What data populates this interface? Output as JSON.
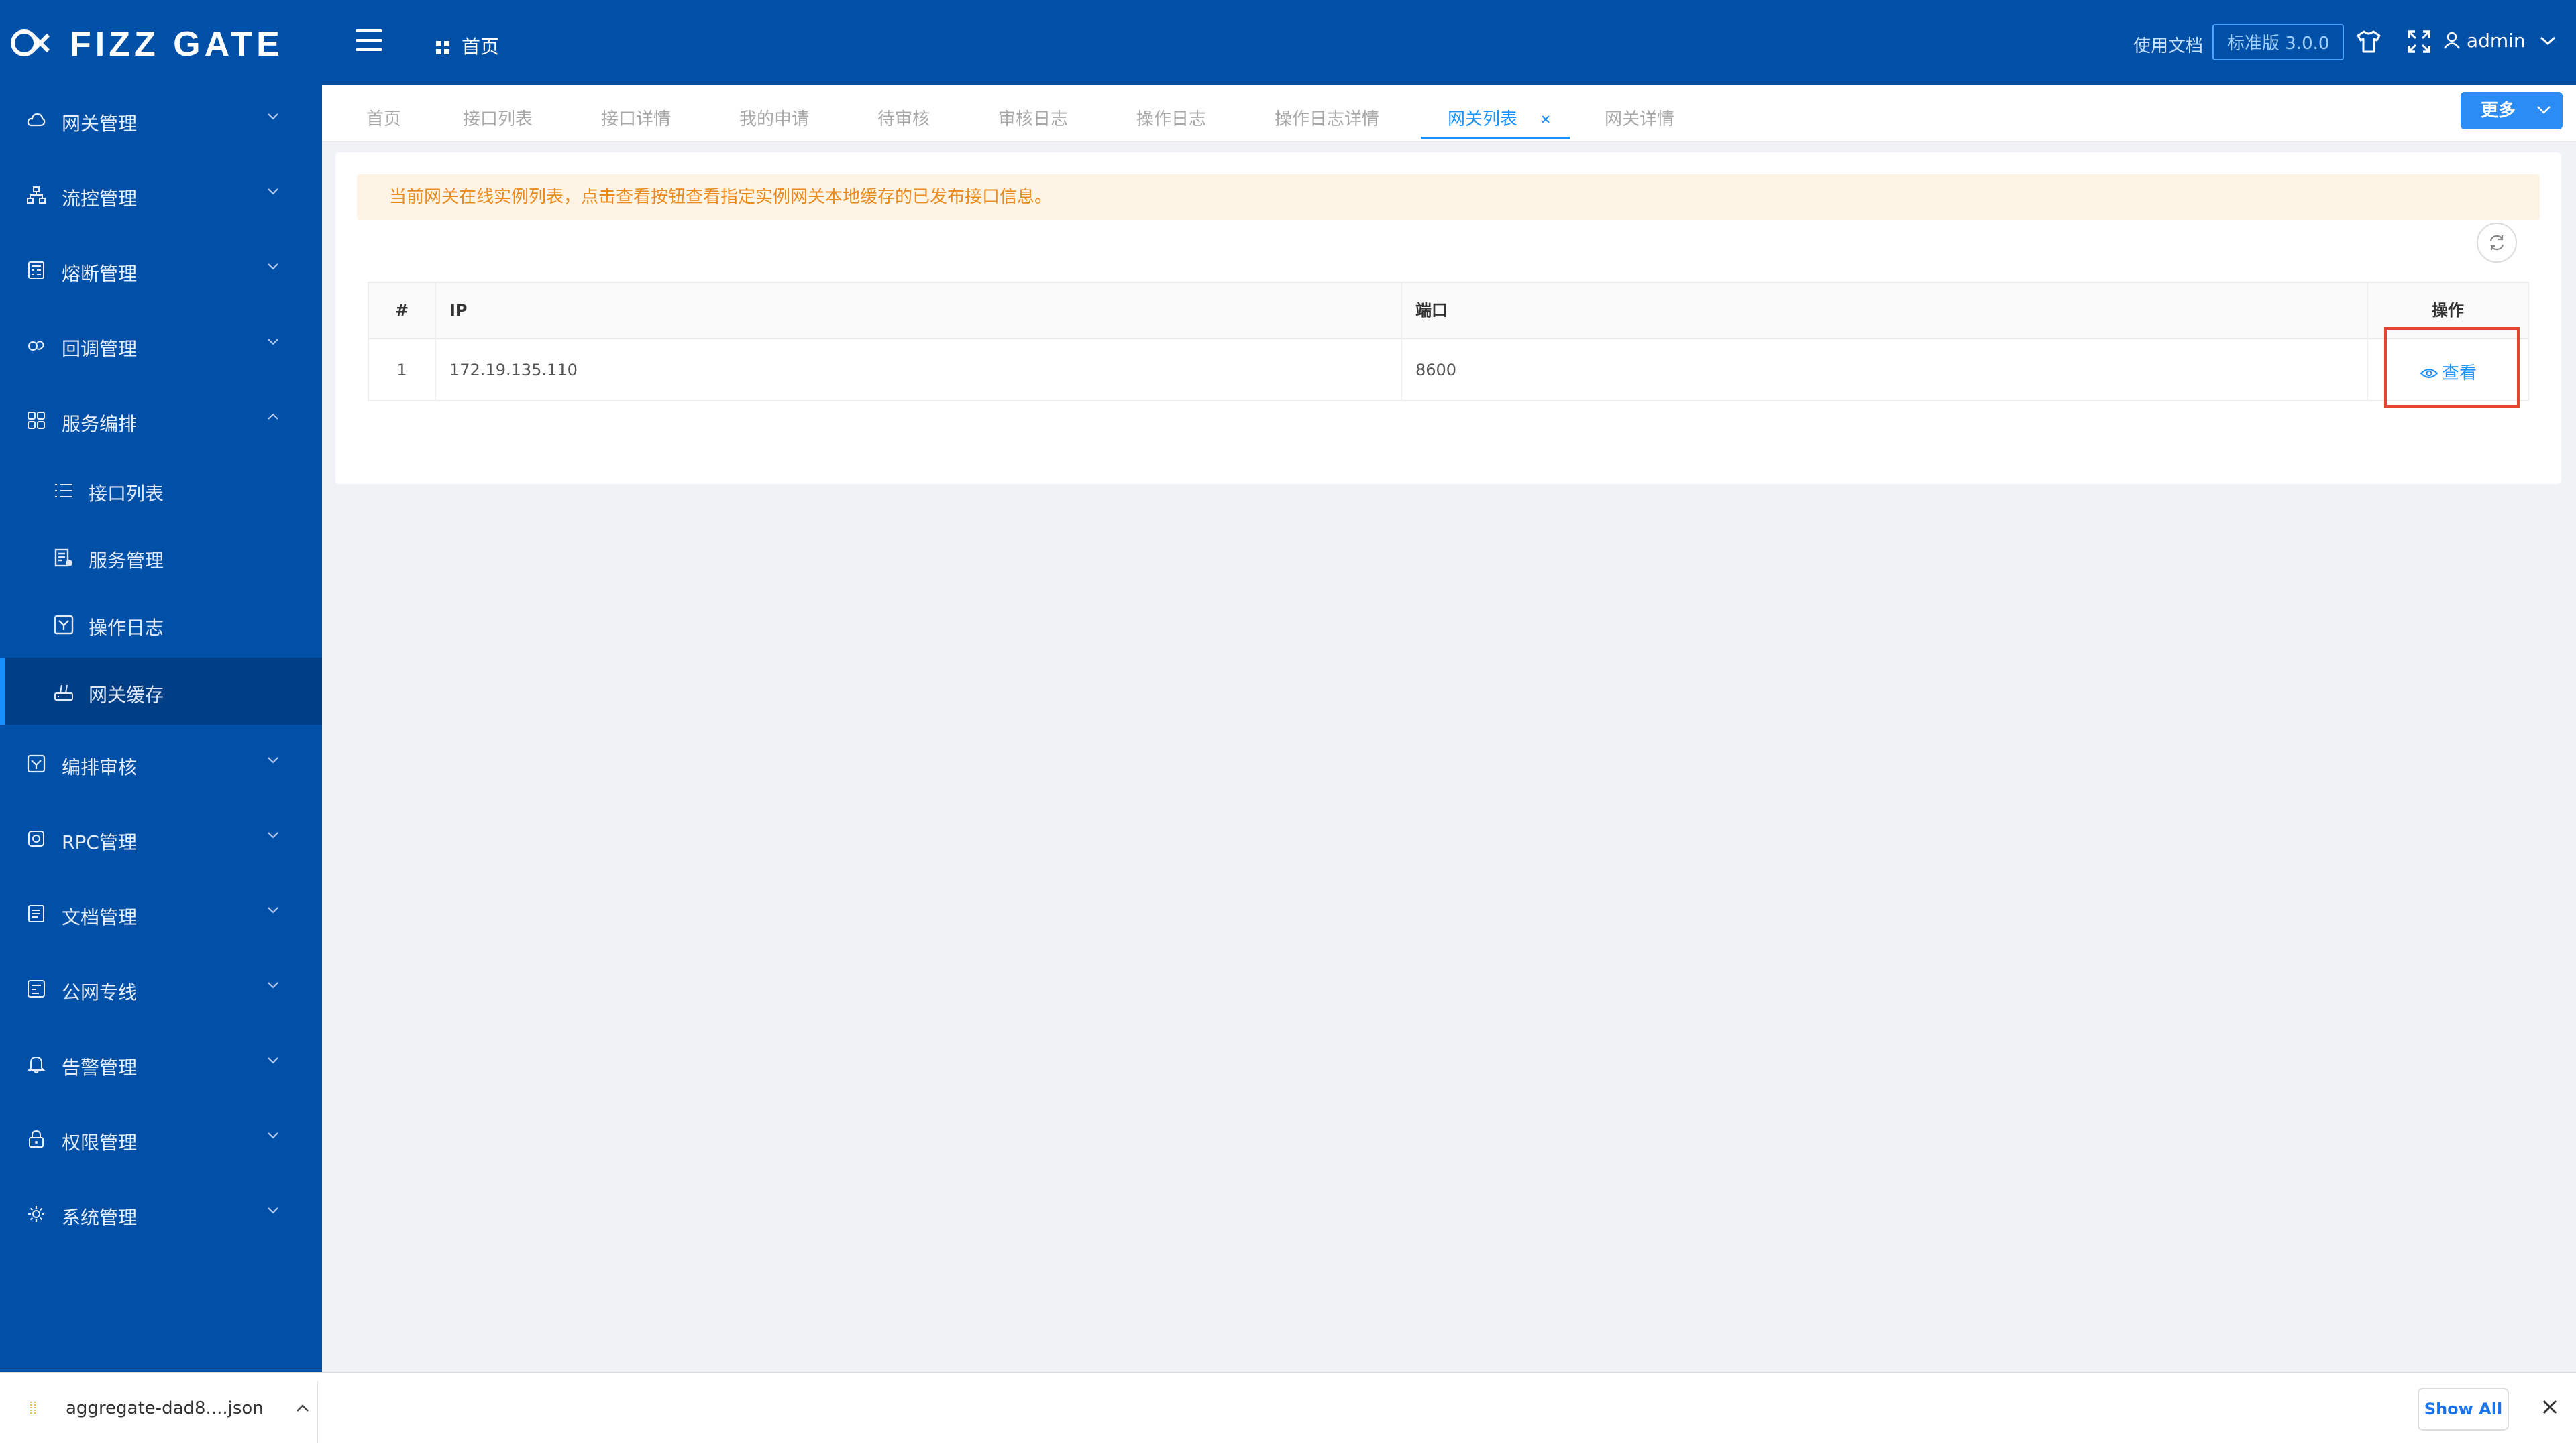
{
  "header": {
    "logo_text": "FIZZ GATE",
    "home_label": "首页",
    "docs_link": "使用文档",
    "version_badge": "标准版 3.0.0",
    "user_name": "admin",
    "bg_color": "#0050a8"
  },
  "sidebar": {
    "items_top": [
      {
        "label": "网关管理",
        "icon": "cloud-icon"
      },
      {
        "label": "流控管理",
        "icon": "sitemap-icon"
      },
      {
        "label": "熔断管理",
        "icon": "calculator-icon"
      },
      {
        "label": "回调管理",
        "icon": "link-icon"
      },
      {
        "label": "服务编排",
        "icon": "apps-icon",
        "expanded": true
      }
    ],
    "sub_items": [
      {
        "label": "接口列表",
        "icon": "list-icon"
      },
      {
        "label": "服务管理",
        "icon": "server-icon"
      },
      {
        "label": "操作日志",
        "icon": "log-icon"
      },
      {
        "label": "网关缓存",
        "icon": "router-icon",
        "active": true
      }
    ],
    "items_bottom": [
      {
        "label": "编排审核",
        "icon": "audit-icon"
      },
      {
        "label": "RPC管理",
        "icon": "rpc-icon"
      },
      {
        "label": "文档管理",
        "icon": "doc-icon"
      },
      {
        "label": "公网专线",
        "icon": "network-icon"
      },
      {
        "label": "告警管理",
        "icon": "bell-icon"
      },
      {
        "label": "权限管理",
        "icon": "lock-icon"
      },
      {
        "label": "系统管理",
        "icon": "gear-icon"
      }
    ]
  },
  "tabs": [
    {
      "label": "首页"
    },
    {
      "label": "接口列表"
    },
    {
      "label": "接口详情"
    },
    {
      "label": "我的申请"
    },
    {
      "label": "待审核"
    },
    {
      "label": "审核日志"
    },
    {
      "label": "操作日志"
    },
    {
      "label": "操作日志详情"
    },
    {
      "label": "网关列表",
      "active": true,
      "closable": true
    },
    {
      "label": "网关详情"
    }
  ],
  "more_button": "更多",
  "alert_text": "当前网关在线实例列表，点击查看按钮查看指定实例网关本地缓存的已发布接口信息。",
  "table": {
    "headers": [
      "#",
      "IP",
      "端口",
      "操作"
    ],
    "rows": [
      {
        "index": "1",
        "ip": "172.19.135.110",
        "port": "8600",
        "action": "查看"
      }
    ]
  },
  "download_bar": {
    "file_name": "aggregate-dad8....json",
    "show_all": "Show All"
  }
}
